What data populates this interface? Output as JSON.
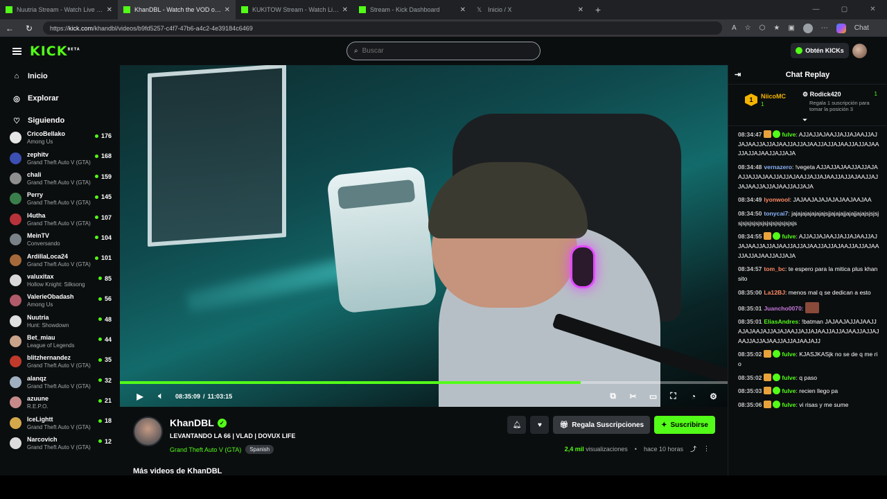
{
  "browser": {
    "tabs": [
      {
        "title": "Nuutria Stream - Watch Live on Kick",
        "active": false
      },
      {
        "title": "KhanDBL - Watch the VOD on Kick",
        "active": true
      },
      {
        "title": "KUKITOW Stream - Watch Live on Kick",
        "active": false
      },
      {
        "title": "Stream - Kick Dashboard",
        "active": false
      },
      {
        "title": "Inicio / X",
        "active": false
      }
    ],
    "url_prefix": "https://",
    "url_domain": "kick.com",
    "url_path": "/khandbl/videos/b9fd5257-c4f7-47b6-a4c2-4e39184c6469",
    "copilot_label": "Chat"
  },
  "header": {
    "logo": "KICK",
    "logo_sup": "BETA",
    "search_placeholder": "Buscar",
    "get_kicks": "Obtén KICKs"
  },
  "sidebar": {
    "nav": [
      {
        "label": "Inicio",
        "icon": "home-icon"
      },
      {
        "label": "Explorar",
        "icon": "compass-icon"
      },
      {
        "label": "Siguiendo",
        "icon": "heart-icon"
      }
    ],
    "channels": [
      {
        "name": "CricoBellako",
        "game": "Among Us",
        "viewers": "176",
        "color": "#e6e6e6"
      },
      {
        "name": "zephitv",
        "game": "Grand Theft Auto V (GTA)",
        "viewers": "168",
        "color": "#3c4fb3"
      },
      {
        "name": "chali",
        "game": "Grand Theft Auto V (GTA)",
        "viewers": "159",
        "color": "#8f8f8f"
      },
      {
        "name": "Perry",
        "game": "Grand Theft Auto V (GTA)",
        "viewers": "145",
        "color": "#3a7f4b"
      },
      {
        "name": "l4utha",
        "game": "Grand Theft Auto V (GTA)",
        "viewers": "107",
        "color": "#b8323a"
      },
      {
        "name": "MeinTV",
        "game": "Conversando",
        "viewers": "104",
        "color": "#7a8288"
      },
      {
        "name": "ArdillaLoca24",
        "game": "Grand Theft Auto V (GTA)",
        "viewers": "101",
        "color": "#a66a3a"
      },
      {
        "name": "valuxitax",
        "game": "Hollow Knight: Silksong",
        "viewers": "85",
        "color": "#d9d9d9"
      },
      {
        "name": "ValerieObadash",
        "game": "Among Us",
        "viewers": "56",
        "color": "#b15a6a"
      },
      {
        "name": "Nuutria",
        "game": "Hunt: Showdown",
        "viewers": "48",
        "color": "#e0e0e0"
      },
      {
        "name": "Bet_miau",
        "game": "League of Legends",
        "viewers": "44",
        "color": "#c9a48a"
      },
      {
        "name": "blitzhernandez",
        "game": "Grand Theft Auto V (GTA)",
        "viewers": "35",
        "color": "#c03a2b"
      },
      {
        "name": "alanqz",
        "game": "Grand Theft Auto V (GTA)",
        "viewers": "32",
        "color": "#9fb0c0"
      },
      {
        "name": "azuune",
        "game": "R.E.P.O.",
        "viewers": "21",
        "color": "#c78a8a"
      },
      {
        "name": "IceLightt",
        "game": "Grand Theft Auto V (GTA)",
        "viewers": "18",
        "color": "#d4a84a"
      },
      {
        "name": "Narcovich",
        "game": "Grand Theft Auto V (GTA)",
        "viewers": "12",
        "color": "#dcdcdc"
      }
    ]
  },
  "player": {
    "progress_fraction": 0.7588,
    "current_time": "08:35:09",
    "separator": "/",
    "duration": "11:03:15"
  },
  "stream": {
    "name": "KhanDBL",
    "title": "LEVANTANDO LA 66  | VLAD | DOVUX LIFE",
    "category": "Grand Theft Auto V (GTA)",
    "language": "Spanish",
    "gift_label": "Regala Suscripciones",
    "subscribe_label": "Suscribirse",
    "views": "2,4 mil",
    "views_suffix": "visualizaciones",
    "dot": "•",
    "ago": "hace 10 horas",
    "more_videos": "Más videos de KhanDBL"
  },
  "chat": {
    "title": "Chat Replay",
    "leader1_rank": "1",
    "leader1_name": "NiicoMC",
    "leader1_count": "1",
    "leader2_name": "Rodick420",
    "leader2_count": "1",
    "leader2_sub": "Regala 1 suscripción para tomar la posición 3",
    "messages": [
      {
        "time": "08:34:47",
        "badges": [
          "crown",
          "verified"
        ],
        "user": "fulve",
        "color": "#53fc18",
        "text": "AJJAJJAJAAJJAJJAJAAJJAJJAJAAJJAJJAJAAJJAJJAJAAJJAJJAJAAJJAJJAJAAJJAJJAJAAJJAJJAJA"
      },
      {
        "time": "08:34:48",
        "badges": [],
        "user": "vernazero",
        "color": "#8ab4f8",
        "text": "!vegeta AJJAJJAJAAJJAJJAJAAJJAJJAJAAJJAJJAJAAJJAJJAJAAJJAJJAJAAJJAJJAJAAJJAJJAJAAJJAJJAJA"
      },
      {
        "time": "08:34:49",
        "badges": [],
        "user": "lyonwool",
        "color": "#ff8a65",
        "text": "JAJAAJAJAJAJAJAAJAAJAA"
      },
      {
        "time": "08:34:50",
        "badges": [],
        "user": "tonycai7",
        "color": "#8ab4f8",
        "text": "jajajajajajajajsjjajajajjajajjajajsjsjsjsjsjsjsjsjsjsjsjsjsjsjsjsjs"
      },
      {
        "time": "08:34:55",
        "badges": [
          "crown",
          "verified"
        ],
        "user": "fulve",
        "color": "#53fc18",
        "text": "AJJAJJAJAAJJAJJAJAAJJAJJAJAAJJAJJAJAAJJAJJAJAAJJAJJAJAAJJAJJAJAAJJAJJAJAAJJAJJAJA"
      },
      {
        "time": "08:34:57",
        "badges": [],
        "user": "tom_bc",
        "color": "#ff8a65",
        "text": "te espero para la mitica plus khansito"
      },
      {
        "time": "08:35:00",
        "badges": [],
        "user": "La12BJ",
        "color": "#ff8a65",
        "text": "menos mal q se dedican a esto"
      },
      {
        "time": "08:35:01",
        "badges": [],
        "user": "Juancho0070",
        "color": "#c678dd",
        "text": "",
        "emote": true
      },
      {
        "time": "08:35:01",
        "badges": [],
        "user": "EliasAndres",
        "color": "#53fc18",
        "text": "!batman JAJAAJAJJAJAAJJAJAJAAJAJJAJAJAAJJAJJAJAAJJAJJAJAAJJAJJAJAAJJAJJAJAAJJAJJAJAAJAJJ"
      },
      {
        "time": "08:35:02",
        "badges": [
          "crown",
          "verified"
        ],
        "user": "fulve",
        "color": "#53fc18",
        "text": "KJASJKASjk no se de q me rio"
      },
      {
        "time": "08:35:02",
        "badges": [
          "crown",
          "verified"
        ],
        "user": "fulve",
        "color": "#53fc18",
        "text": "q paso"
      },
      {
        "time": "08:35:03",
        "badges": [
          "crown",
          "verified"
        ],
        "user": "fulve",
        "color": "#53fc18",
        "text": "recien llego pa"
      },
      {
        "time": "08:35:06",
        "badges": [
          "crown",
          "verified"
        ],
        "user": "fulve",
        "color": "#53fc18",
        "text": "vi risas y me sume"
      }
    ]
  }
}
